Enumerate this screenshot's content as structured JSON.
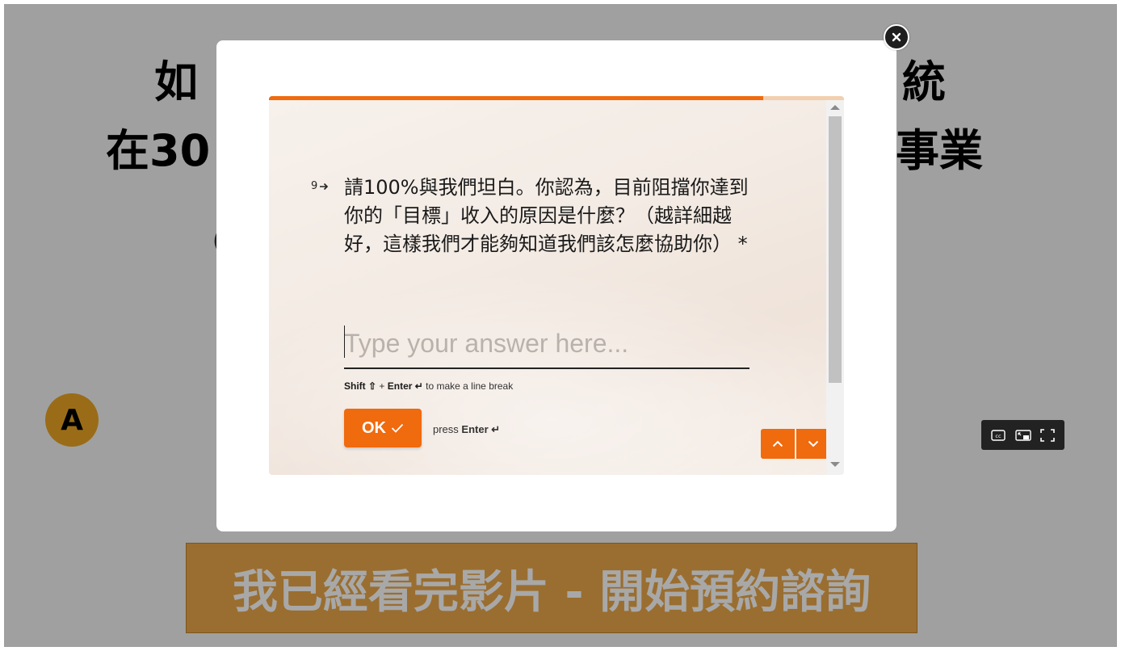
{
  "background": {
    "headline_line1_left": "如",
    "headline_line1_right": "統",
    "headline_line2_left": "在30",
    "headline_line2_right": "事業",
    "paren_fragment": "(",
    "avatar_letter": "A",
    "cta_label": "我已經看完影片 - 開始預約諮詢"
  },
  "video_controls": {
    "icons": [
      "closed-captions-icon",
      "picture-in-picture-icon",
      "fullscreen-icon"
    ]
  },
  "form": {
    "progress_percent": 86,
    "question_number": "9",
    "question_text": "請100%與我們坦白。你認為，目前阻擋你達到你的「目標」收入的原因是什麼？（越詳細越好，這樣我們才能夠知道我們該怎麼協助你） *",
    "answer_placeholder": "Type your answer here...",
    "answer_value": "",
    "hint_shift": "Shift ⇧",
    "hint_plus": " + ",
    "hint_enter": "Enter ↵",
    "hint_rest": " to make a line break",
    "ok_label": "OK",
    "press_label": "press ",
    "press_enter": "Enter ↵"
  },
  "colors": {
    "accent": "#f06a0e",
    "overlay": "#a0a0a0",
    "cta": "#9a6e30"
  }
}
